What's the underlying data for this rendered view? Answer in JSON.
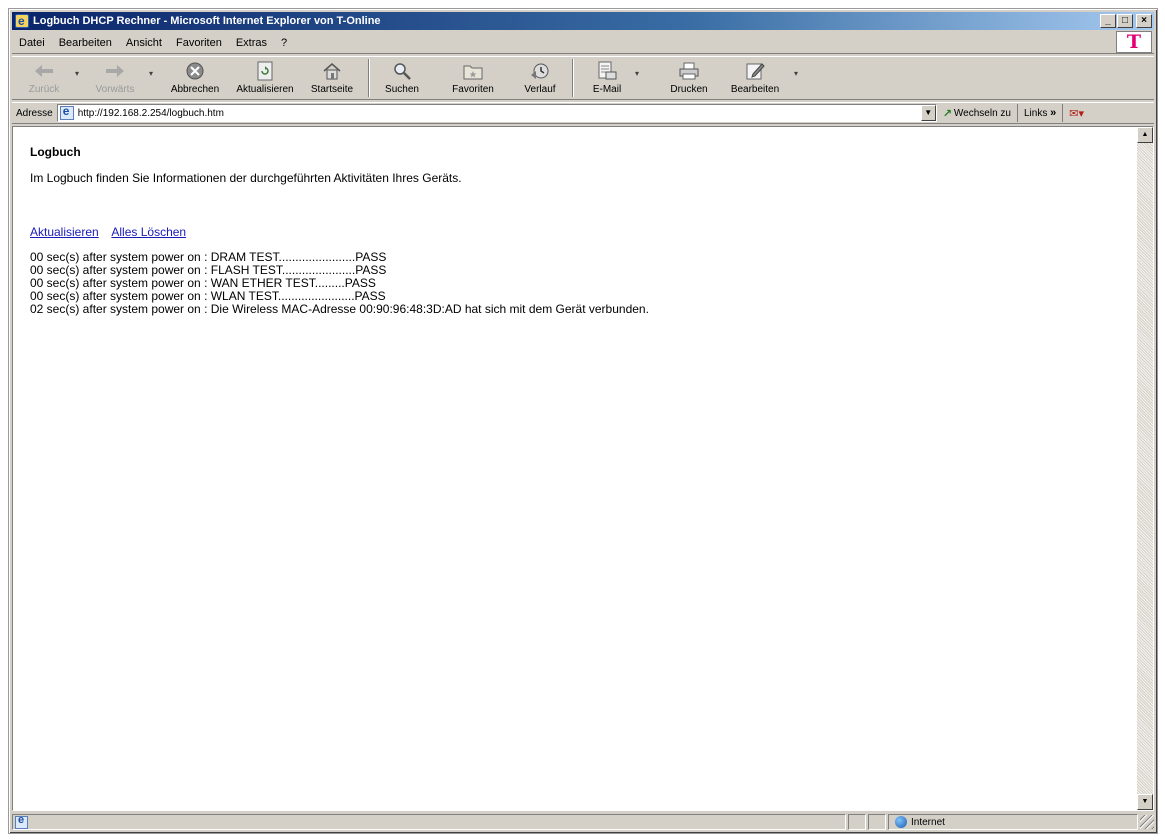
{
  "window": {
    "title": "Logbuch DHCP Rechner - Microsoft Internet Explorer von T-Online"
  },
  "menu": {
    "items": [
      "Datei",
      "Bearbeiten",
      "Ansicht",
      "Favoriten",
      "Extras",
      "?"
    ],
    "brand_logo": "T"
  },
  "toolbar": {
    "back": "Zurück",
    "forward": "Vorwärts",
    "stop": "Abbrechen",
    "refresh": "Aktualisieren",
    "home": "Startseite",
    "search": "Suchen",
    "favorites": "Favoriten",
    "history": "Verlauf",
    "mail": "E-Mail",
    "print": "Drucken",
    "edit": "Bearbeiten"
  },
  "address": {
    "label": "Adresse",
    "url": "http://192.168.2.254/logbuch.htm",
    "go": "Wechseln zu",
    "links": "Links"
  },
  "page": {
    "heading": "Logbuch",
    "intro": "Im Logbuch finden Sie Informationen der durchgeführten Aktivitäten Ihres Geräts.",
    "refresh_link": "Aktualisieren",
    "clear_link": "Alles Löschen",
    "log": [
      "00 sec(s) after system power on : DRAM TEST.......................PASS",
      "00 sec(s) after system power on : FLASH TEST......................PASS",
      "00 sec(s) after system power on : WAN ETHER TEST.........PASS",
      "00 sec(s) after system power on : WLAN TEST.......................PASS",
      "02 sec(s) after system power on : Die Wireless MAC-Adresse 00:90:96:48:3D:AD hat sich mit dem Gerät verbunden."
    ]
  },
  "status": {
    "zone": "Internet"
  },
  "colors": {
    "titlebar": "#0a246a",
    "chrome": "#d4d0c8",
    "link": "#1a1ab8",
    "brand": "#e20074"
  }
}
